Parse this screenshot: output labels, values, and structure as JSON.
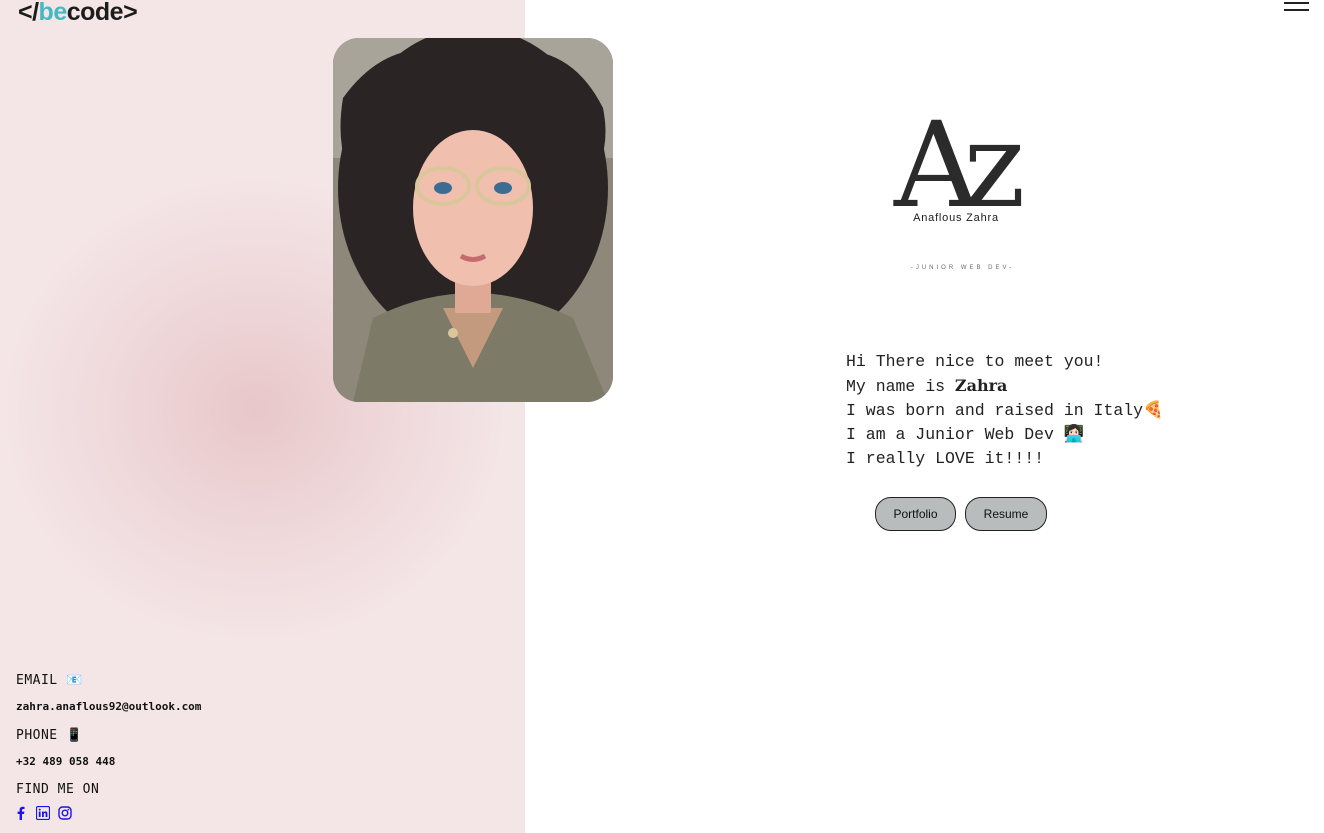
{
  "logo": {
    "left": "</",
    "mid": "be",
    "right": "code>"
  },
  "nav": {
    "menu_icon": "hamburger-menu-icon"
  },
  "brand": {
    "monogram": "Az",
    "name": "Anaflous Zahra",
    "tagline": "-JUNIOR WEB DEV-"
  },
  "intro": {
    "line1": "Hi There nice to meet you!",
    "line2_prefix": "My name is ",
    "line2_name": "Zahra",
    "line3": "I was born and raised in Italy",
    "line3_emoji": "🍕",
    "line4": "I am a Junior Web Dev ",
    "line4_emoji": "👩🏻‍💻",
    "line5": "I really LOVE it!!!!"
  },
  "buttons": {
    "portfolio": "Portfolio",
    "resume": "Resume"
  },
  "contact": {
    "email_label": "EMAIL",
    "email_icon": "📧",
    "email_value": "zahra.anaflous92@outlook.com",
    "phone_label": "PHONE",
    "phone_icon": "📱",
    "phone_value": "+32 489 058 448",
    "find_label": "FIND ME ON"
  },
  "socials": [
    "facebook-icon",
    "linkedin-icon",
    "instagram-icon"
  ],
  "colors": {
    "accent": "#44b9c4",
    "social": "#1a14e6",
    "button_bg": "#b8bcbd",
    "panel": "#f4e6e7"
  }
}
